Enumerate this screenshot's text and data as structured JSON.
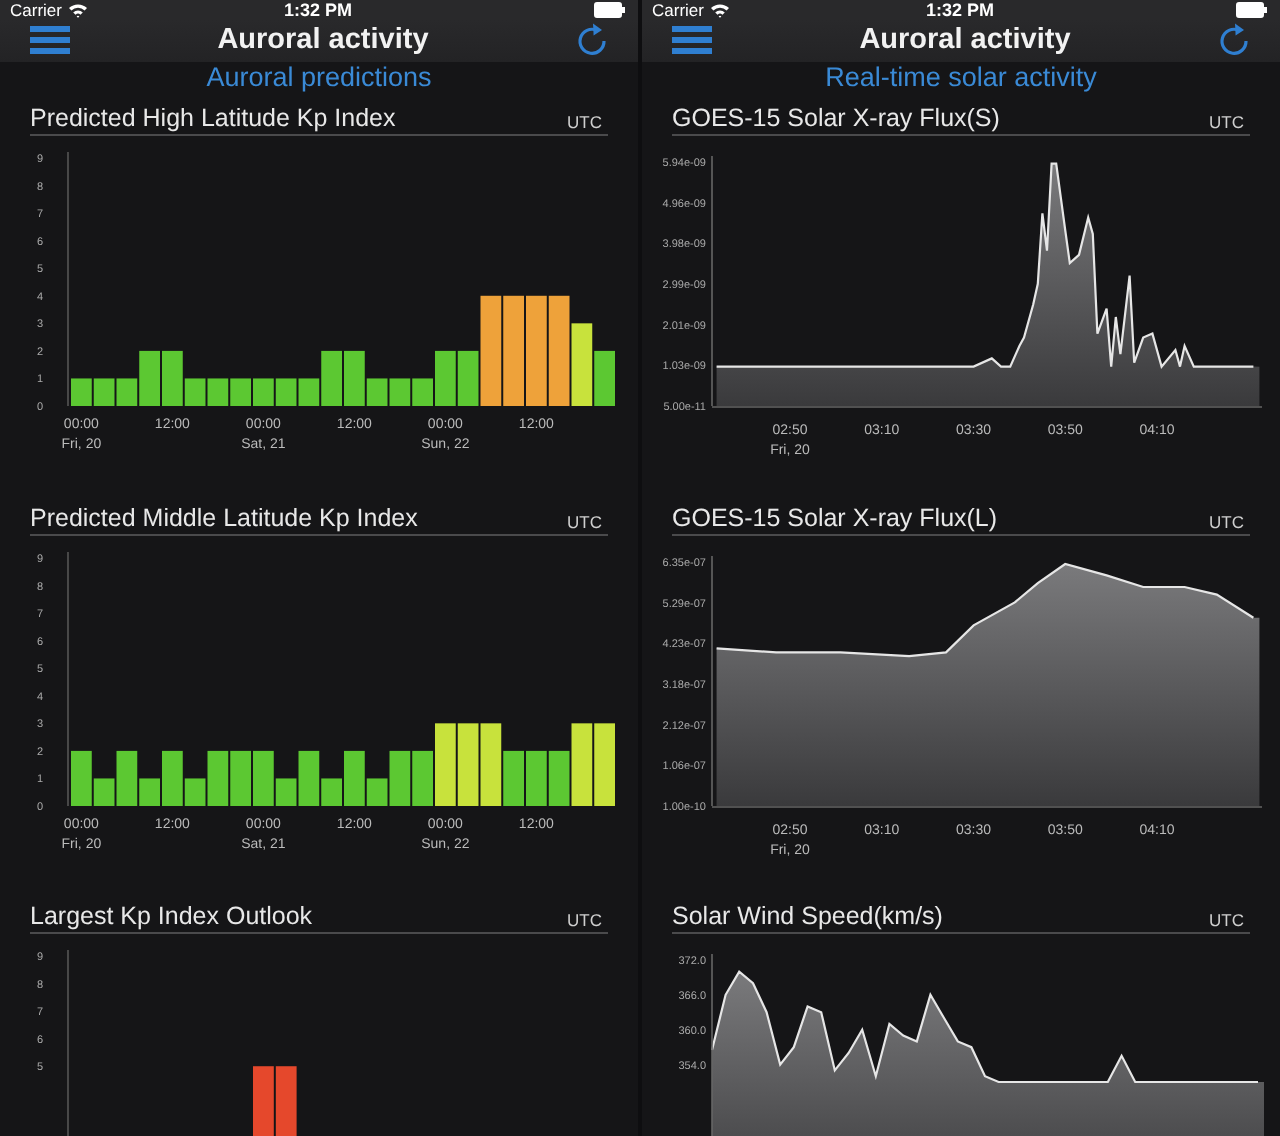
{
  "screens": [
    {
      "status_bar": {
        "carrier": "Carrier",
        "time": "1:32 PM"
      },
      "nav_bar": {
        "title": "Auroral activity"
      },
      "subtitle": "Auroral predictions",
      "panels": [
        {
          "title": "Predicted High Latitude Kp Index",
          "timezone": "UTC",
          "chart_data": {
            "type": "bar",
            "categories": [
              "00:00",
              null,
              null,
              null,
              "12:00",
              null,
              null,
              null,
              "00:00",
              null,
              null,
              null,
              "12:00",
              null,
              null,
              null,
              "00:00",
              null,
              null,
              null,
              "12:00",
              null,
              null,
              null
            ],
            "ylim": [
              0,
              9
            ],
            "yticks": [
              0,
              1,
              2,
              3,
              4,
              5,
              6,
              7,
              8,
              9
            ],
            "values": [
              1,
              1,
              1,
              2,
              2,
              1,
              1,
              1,
              1,
              1,
              1,
              2,
              2,
              1,
              1,
              1,
              2,
              2,
              4,
              4,
              4,
              4,
              3,
              2
            ]
          },
          "x_axis_dates": [
            "Fri, 20",
            "Sat, 21",
            "Sun, 22"
          ]
        },
        {
          "title": "Predicted Middle Latitude Kp Index",
          "timezone": "UTC",
          "chart_data": {
            "type": "bar",
            "categories": [
              "00:00",
              null,
              null,
              null,
              "12:00",
              null,
              null,
              null,
              "00:00",
              null,
              null,
              null,
              "12:00",
              null,
              null,
              null,
              "00:00",
              null,
              null,
              null,
              "12:00",
              null,
              null,
              null
            ],
            "ylim": [
              0,
              9
            ],
            "yticks": [
              0,
              1,
              2,
              3,
              4,
              5,
              6,
              7,
              8,
              9
            ],
            "values": [
              2,
              1,
              2,
              1,
              2,
              1,
              2,
              2,
              2,
              1,
              2,
              1,
              2,
              1,
              2,
              2,
              3,
              3,
              3,
              2,
              2,
              2,
              3,
              3
            ]
          },
          "x_axis_dates": [
            "Fri, 20",
            "Sat, 21",
            "Sun, 22"
          ]
        },
        {
          "title": "Largest Kp Index Outlook",
          "timezone": "UTC",
          "y_axis_labels": [
            "9",
            "8",
            "7",
            "6",
            "5"
          ]
        }
      ]
    },
    {
      "status_bar": {
        "carrier": "Carrier",
        "time": "1:32 PM"
      },
      "nav_bar": {
        "title": "Auroral activity"
      },
      "subtitle": "Real-time solar activity",
      "panels": [
        {
          "title": "GOES-15 Solar X-ray Flux(S)",
          "timezone": "UTC",
          "chart_data": {
            "type": "area",
            "xlim": [
              153,
              272
            ],
            "ylim": [
              5e-11,
              5.94e-09
            ],
            "yticks": [
              {
                "value": 5e-11,
                "label": "5.00e-11"
              },
              {
                "value": 1.03e-09,
                "label": "1.03e-09"
              },
              {
                "value": 2.01e-09,
                "label": "2.01e-09"
              },
              {
                "value": 2.99e-09,
                "label": "2.99e-09"
              },
              {
                "value": 3.98e-09,
                "label": "3.98e-09"
              },
              {
                "value": 4.96e-09,
                "label": "4.96e-09"
              },
              {
                "value": 5.94e-09,
                "label": "5.94e-09"
              }
            ],
            "xticks": [
              {
                "value": 170,
                "label": "02:50"
              },
              {
                "value": 190,
                "label": "03:10"
              },
              {
                "value": 210,
                "label": "03:30"
              },
              {
                "value": 230,
                "label": "03:50"
              },
              {
                "value": 250,
                "label": "04:10"
              }
            ],
            "x": [
              154,
              210,
              214,
              216,
              218,
              220,
              221,
              223,
              224,
              225,
              226,
              227,
              228,
              230,
              231,
              233,
              235,
              236,
              237,
              239,
              240,
              241,
              242,
              244,
              245,
              247,
              249,
              251,
              254,
              255,
              256,
              258,
              271
            ],
            "values": [
              1e-09,
              1e-09,
              1.2e-09,
              1e-09,
              1e-09,
              1.5e-09,
              1.7e-09,
              2.5e-09,
              3e-09,
              4.7e-09,
              3.8e-09,
              5.9e-09,
              5.9e-09,
              4.3e-09,
              3.5e-09,
              3.7e-09,
              4.6e-09,
              4.2e-09,
              1.8e-09,
              2.4e-09,
              1e-09,
              2.2e-09,
              1.3e-09,
              3.2e-09,
              1.1e-09,
              1.7e-09,
              1.8e-09,
              1e-09,
              1.4e-09,
              1e-09,
              1.5e-09,
              1e-09,
              1e-09
            ]
          },
          "x_axis_dates": [
            "Fri, 20"
          ]
        },
        {
          "title": "GOES-15 Solar X-ray Flux(L)",
          "timezone": "UTC",
          "chart_data": {
            "type": "area",
            "xlim": [
              153,
              272
            ],
            "ylim": [
              1e-10,
              6.35e-07
            ],
            "yticks": [
              {
                "value": 1e-10,
                "label": "1.00e-10"
              },
              {
                "value": 1.06e-07,
                "label": "1.06e-07"
              },
              {
                "value": 2.12e-07,
                "label": "2.12e-07"
              },
              {
                "value": 3.18e-07,
                "label": "3.18e-07"
              },
              {
                "value": 4.23e-07,
                "label": "4.23e-07"
              },
              {
                "value": 5.29e-07,
                "label": "5.29e-07"
              },
              {
                "value": 6.35e-07,
                "label": "6.35e-07"
              }
            ],
            "xticks": [
              {
                "value": 170,
                "label": "02:50"
              },
              {
                "value": 190,
                "label": "03:10"
              },
              {
                "value": 210,
                "label": "03:30"
              },
              {
                "value": 230,
                "label": "03:50"
              },
              {
                "value": 250,
                "label": "04:10"
              }
            ],
            "x": [
              154,
              167,
              181,
              196,
              204,
              210,
              219,
              224,
              230,
              239,
              247,
              256,
              263,
              271
            ],
            "values": [
              4.1e-07,
              4e-07,
              4e-07,
              3.9e-07,
              4e-07,
              4.7e-07,
              5.3e-07,
              5.8e-07,
              6.3e-07,
              6e-07,
              5.7e-07,
              5.7e-07,
              5.5e-07,
              4.9e-07
            ]
          },
          "x_axis_dates": [
            "Fri, 20"
          ]
        },
        {
          "title": "Solar Wind Speed(km/s)",
          "timezone": "UTC",
          "chart_data": {
            "type": "area",
            "ylim": [
              330,
              372
            ],
            "categories": [
              null,
              null,
              null,
              null,
              null,
              null,
              null,
              null,
              null,
              null,
              null,
              null,
              null,
              null,
              null,
              null,
              null,
              null,
              null,
              null,
              null,
              null,
              null,
              null,
              null,
              null,
              null,
              null,
              null,
              null,
              null,
              null,
              null,
              null,
              null,
              null,
              null,
              null,
              null,
              null,
              null
            ],
            "yticks": [
              {
                "value": 354,
                "label": "354.0"
              },
              {
                "value": 360,
                "label": "360.0"
              },
              {
                "value": 366,
                "label": "366.0"
              },
              {
                "value": 372,
                "label": "372.0"
              }
            ],
            "series": [
              {
                "color": "#e6e6e6",
                "values": [
                  356.5,
                  366,
                  370,
                  368,
                  363,
                  354,
                  357,
                  364,
                  363,
                  353,
                  356,
                  360,
                  352,
                  361,
                  359,
                  358,
                  366,
                  362,
                  358,
                  357,
                  352,
                  351,
                  351,
                  351,
                  351,
                  351,
                  351,
                  351,
                  351,
                  351,
                  355.5,
                  351,
                  351,
                  351,
                  351,
                  351,
                  351,
                  351,
                  351,
                  351,
                  351
                ]
              }
            ]
          }
        }
      ]
    }
  ]
}
